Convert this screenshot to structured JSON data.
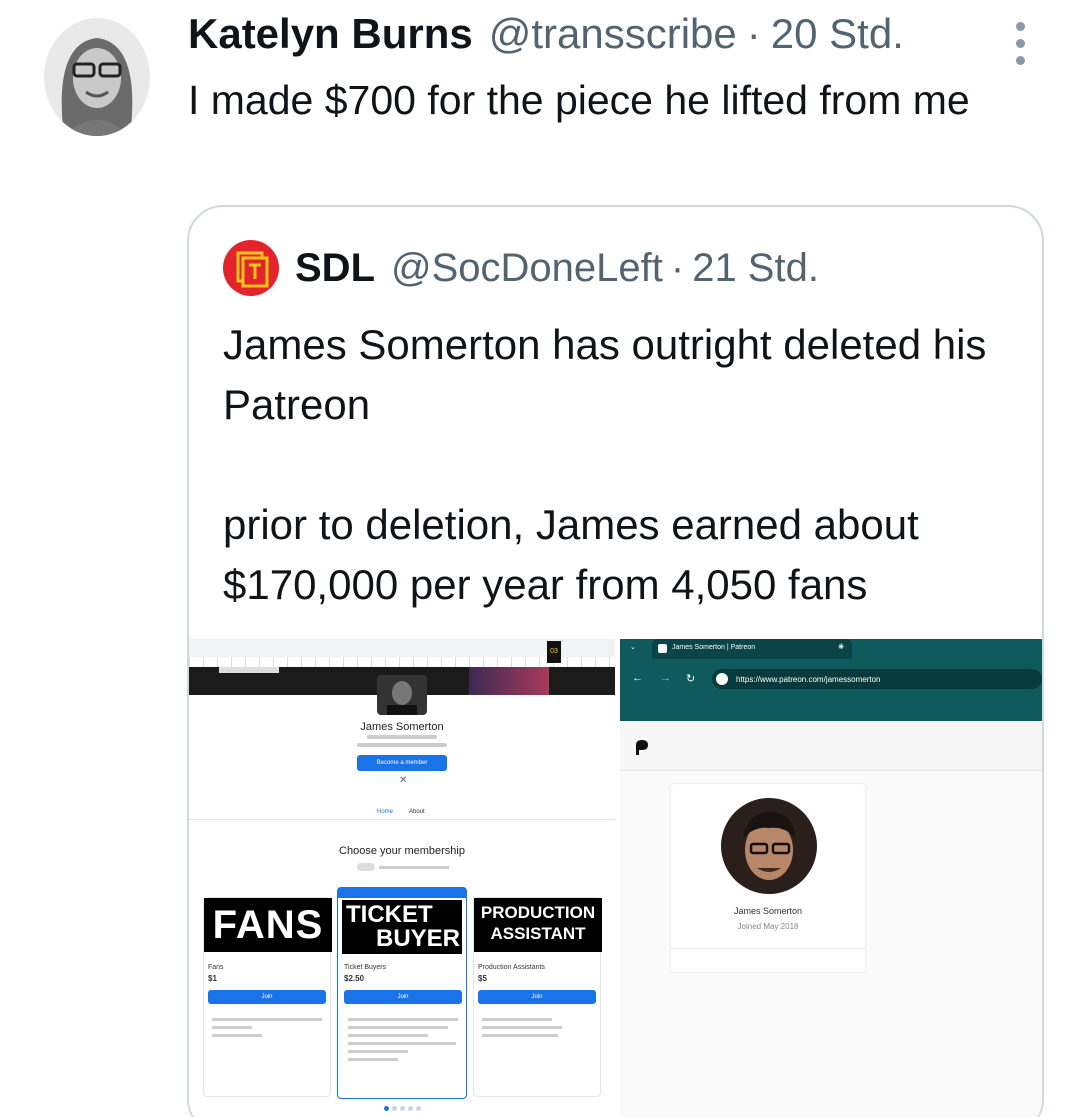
{
  "tweet": {
    "author_name": "Katelyn Burns",
    "handle": "@transscribe",
    "separator": "·",
    "time": "20 Std.",
    "text": "I made $700 for the piece he lifted from me"
  },
  "quoted": {
    "author_name": "SDL",
    "handle": "@SocDoneLeft",
    "separator": "·",
    "time": "21 Std.",
    "text_p1": "James Somerton has outright deleted his Patreon",
    "text_p2": "prior to deletion, James earned about $170,000 per year from 4,050 fans"
  },
  "left_shot": {
    "profile_name": "James Somerton",
    "become_member": "Become a member",
    "tab_home": "Home",
    "tab_about": "About",
    "choose_title": "Choose your membership",
    "tier1_img": "FANS",
    "tier2_img_line1": "TICKET",
    "tier2_img_line2": "BUYER",
    "tier3_img_line1": "PRODUCTION",
    "tier3_img_line2": "ASSISTANT",
    "tier1_name": "Fans",
    "tier1_price": "$1",
    "tier2_name": "Ticket Buyers",
    "tier2_price": "$2.50",
    "tier3_name": "Production Assistants",
    "tier3_price": "$5",
    "join": "Join",
    "badge_time": "03"
  },
  "right_shot": {
    "tab_title": "James Somerton | Patreon",
    "url": "https://www.patreon.com/jamessomerton",
    "profile_name": "James Somerton",
    "joined": "Joined May 2018"
  },
  "colors": {
    "accent": "#1d6fe8",
    "teal": "#0e5a5d",
    "gray": "#536471"
  }
}
